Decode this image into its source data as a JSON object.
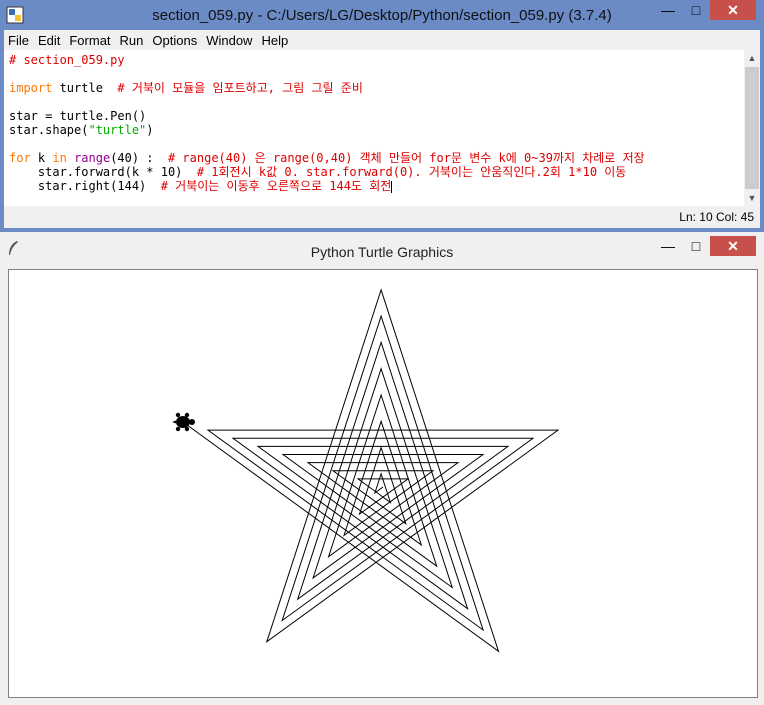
{
  "idle": {
    "title": "section_059.py - C:/Users/LG/Desktop/Python/section_059.py (3.7.4)",
    "menu": [
      "File",
      "Edit",
      "Format",
      "Run",
      "Options",
      "Window",
      "Help"
    ],
    "code": {
      "line1": "# section_059.py",
      "line3_keyword": "import",
      "line3_plain": " turtle  ",
      "line3_comment": "# 거북이 모듈을 임포트하고, 그림 그릴 준비",
      "line5": "star = turtle.Pen()",
      "line6_plain": "star.shape(",
      "line6_string": "\"turtle\"",
      "line6_close": ")",
      "line8_for": "for",
      "line8_k": " k ",
      "line8_in": "in",
      "line8_sp": " ",
      "line8_range": "range",
      "line8_args": "(40) :  ",
      "line8_comment": "# range(40) 은 range(0,40) 객체 만들어 for문 변수 k에 0~39까지 차례로 저장",
      "line9_plain": "    star.forward(k * 10)  ",
      "line9_comment": "# 1회전시 k값 0. star.forward(0). 거북이는 안움직인다.2회 1*10 이동",
      "line10_plain": "    star.right(144)  ",
      "line10_comment": "# 거북이는 이동후 오른쪽으로 144도 회전"
    },
    "status": "Ln: 10  Col: 45"
  },
  "turtle_window": {
    "title": "Python Turtle Graphics"
  },
  "colors": {
    "titlebar": "#6b8bc6",
    "close": "#c7504b",
    "comment": "#dd0000",
    "keyword": "#ff7700",
    "builtin": "#900090",
    "string": "#00aa00"
  },
  "icons": {
    "idle_app": "python-idle-icon",
    "turtle_app": "feather-icon",
    "minimize": "minimize-icon",
    "maximize": "maximize-icon",
    "close": "close-icon"
  }
}
